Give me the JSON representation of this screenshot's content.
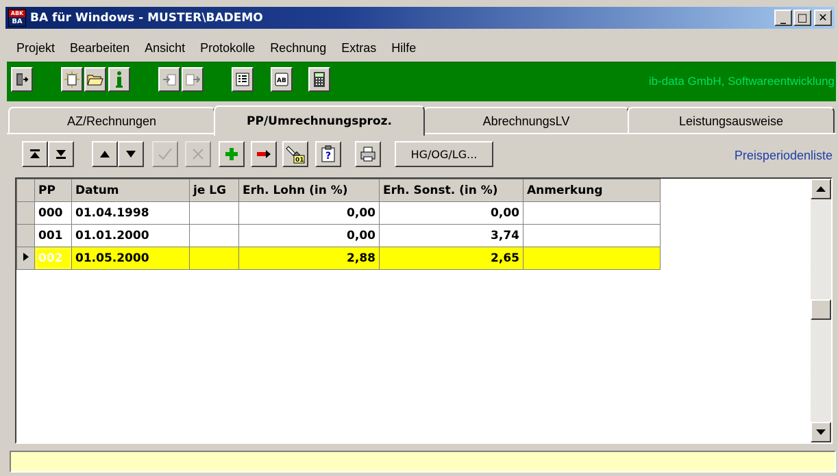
{
  "window": {
    "title": "BA für Windows - MUSTER\\BADEMO",
    "icon_top": "ABK",
    "icon_bottom": "BA",
    "minimize_label": "_",
    "maximize_label": "□",
    "close_label": "✕"
  },
  "menu": [
    "Projekt",
    "Bearbeiten",
    "Ansicht",
    "Protokolle",
    "Rechnung",
    "Extras",
    "Hilfe"
  ],
  "toolbar": {
    "company": "ib-data GmbH, Softwareentwicklung",
    "icons": [
      "exit-icon",
      "new-icon",
      "open-folder-icon",
      "info-icon",
      "import-icon",
      "export-icon",
      "tree-list-icon",
      "ab-document-icon",
      "calculator-icon"
    ]
  },
  "tabs": [
    {
      "label": "AZ/Rechnungen",
      "active": false
    },
    {
      "label": "PP/Umrechnungsproz.",
      "active": true
    },
    {
      "label": "AbrechnungsLV",
      "active": false
    },
    {
      "label": "Leistungsausweise",
      "active": false
    }
  ],
  "grid_toolbar": {
    "hg_button_label": "HG/OG/LG...",
    "list_label": "Preisperiodenliste",
    "search_badge": "01"
  },
  "grid": {
    "columns": [
      "PP",
      "Datum",
      "je LG",
      "Erh. Lohn (in %)",
      "Erh. Sonst. (in %)",
      "Anmerkung"
    ],
    "rows": [
      {
        "pp": "000",
        "datum": "01.04.1998",
        "je_lg": "",
        "lohn": "0,00",
        "sonst": "0,00",
        "anmerkung": "",
        "selected": false
      },
      {
        "pp": "001",
        "datum": "01.01.2000",
        "je_lg": "",
        "lohn": "0,00",
        "sonst": "3,74",
        "anmerkung": "",
        "selected": false
      },
      {
        "pp": "002",
        "datum": "01.05.2000",
        "je_lg": "",
        "lohn": "2,88",
        "sonst": "2,65",
        "anmerkung": "",
        "selected": true
      }
    ]
  },
  "colors": {
    "titlebar": "#0a246a",
    "toolbar_green": "#008000",
    "company_text": "#00e060",
    "selected_row": "#ffff00",
    "list_label": "#1f3ea8",
    "statusbar": "#ffffc0"
  },
  "statusbar": {
    "text": ""
  }
}
